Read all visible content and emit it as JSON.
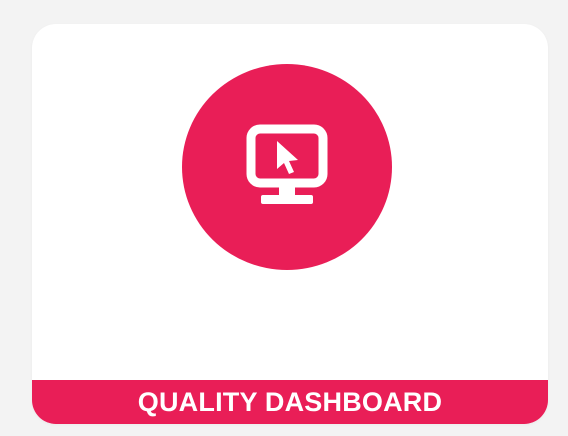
{
  "tile": {
    "label": "QUALITY DASHBOARD",
    "icon": "monitor-cursor-icon",
    "accent_color": "#e91e57",
    "icon_color": "#ffffff",
    "background_color": "#ffffff"
  }
}
